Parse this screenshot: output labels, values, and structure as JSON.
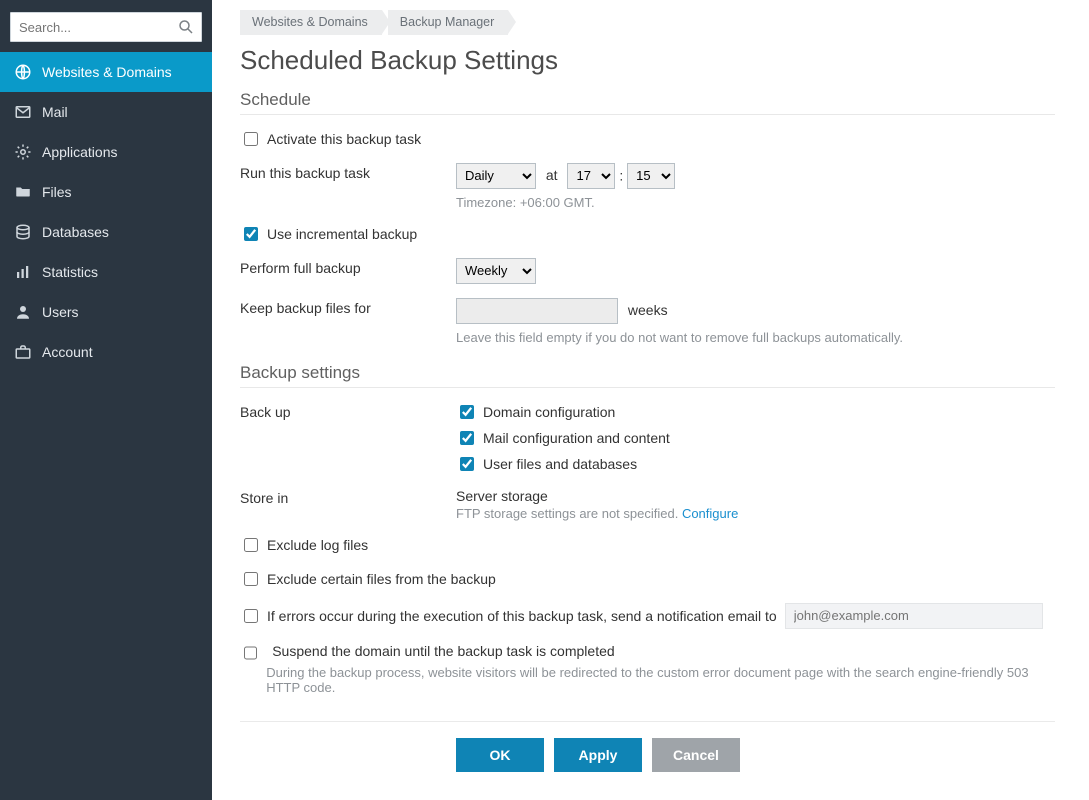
{
  "sidebar": {
    "search_placeholder": "Search...",
    "items": [
      {
        "label": "Websites & Domains"
      },
      {
        "label": "Mail"
      },
      {
        "label": "Applications"
      },
      {
        "label": "Files"
      },
      {
        "label": "Databases"
      },
      {
        "label": "Statistics"
      },
      {
        "label": "Users"
      },
      {
        "label": "Account"
      }
    ]
  },
  "breadcrumb": {
    "items": [
      {
        "label": "Websites & Domains"
      },
      {
        "label": "Backup Manager"
      }
    ]
  },
  "page": {
    "title": "Scheduled Backup Settings"
  },
  "sections": {
    "schedule": {
      "title": "Schedule"
    },
    "settings": {
      "title": "Backup settings"
    }
  },
  "schedule": {
    "activate_label": "Activate this backup task",
    "activate_checked": false,
    "run_label": "Run this backup task",
    "frequency_selected": "Daily",
    "at_label": "at",
    "hour_selected": "17",
    "minute_selected": "15",
    "colon": ":",
    "timezone_note": "Timezone: +06:00 GMT.",
    "incremental_label": "Use incremental backup",
    "incremental_checked": true,
    "full_label": "Perform full backup",
    "full_freq_selected": "Weekly",
    "keep_label": "Keep backup files for",
    "keep_value": "",
    "keep_unit": "weeks",
    "keep_hint": "Leave this field empty if you do not want to remove full backups automatically."
  },
  "settings": {
    "backup_label": "Back up",
    "domain_cfg_label": "Domain configuration",
    "domain_cfg_checked": true,
    "mail_cfg_label": "Mail configuration and content",
    "mail_cfg_checked": true,
    "user_files_label": "User files and databases",
    "user_files_checked": true,
    "store_label": "Store in",
    "store_value": "Server storage",
    "ftp_note": "FTP storage settings are not specified. ",
    "ftp_configure_link": "Configure",
    "exclude_log_label": "Exclude log files",
    "exclude_log_checked": false,
    "exclude_certain_label": "Exclude certain files from the backup",
    "exclude_certain_checked": false,
    "notify_label": "If errors occur during the execution of this backup task, send a notification email to",
    "notify_checked": false,
    "notify_email_placeholder": "john@example.com",
    "suspend_label": "Suspend the domain until the backup task is completed",
    "suspend_checked": false,
    "suspend_hint": "During the backup process, website visitors will be redirected to the custom error document page with the search engine-friendly 503 HTTP code."
  },
  "actions": {
    "ok": "OK",
    "apply": "Apply",
    "cancel": "Cancel"
  }
}
